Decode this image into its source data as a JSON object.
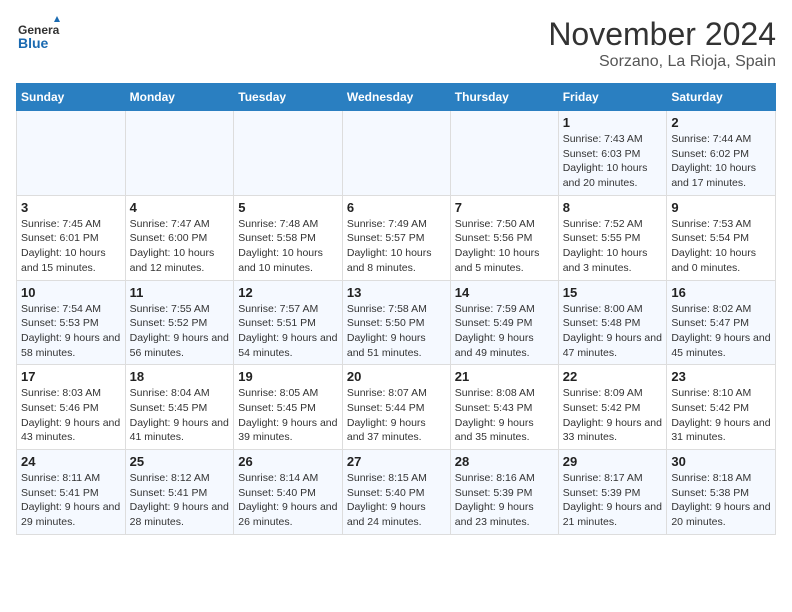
{
  "header": {
    "logo_line1": "General",
    "logo_line2": "Blue",
    "month": "November 2024",
    "location": "Sorzano, La Rioja, Spain"
  },
  "days_of_week": [
    "Sunday",
    "Monday",
    "Tuesday",
    "Wednesday",
    "Thursday",
    "Friday",
    "Saturday"
  ],
  "weeks": [
    [
      {
        "day": "",
        "info": ""
      },
      {
        "day": "",
        "info": ""
      },
      {
        "day": "",
        "info": ""
      },
      {
        "day": "",
        "info": ""
      },
      {
        "day": "",
        "info": ""
      },
      {
        "day": "1",
        "info": "Sunrise: 7:43 AM\nSunset: 6:03 PM\nDaylight: 10 hours and 20 minutes."
      },
      {
        "day": "2",
        "info": "Sunrise: 7:44 AM\nSunset: 6:02 PM\nDaylight: 10 hours and 17 minutes."
      }
    ],
    [
      {
        "day": "3",
        "info": "Sunrise: 7:45 AM\nSunset: 6:01 PM\nDaylight: 10 hours and 15 minutes."
      },
      {
        "day": "4",
        "info": "Sunrise: 7:47 AM\nSunset: 6:00 PM\nDaylight: 10 hours and 12 minutes."
      },
      {
        "day": "5",
        "info": "Sunrise: 7:48 AM\nSunset: 5:58 PM\nDaylight: 10 hours and 10 minutes."
      },
      {
        "day": "6",
        "info": "Sunrise: 7:49 AM\nSunset: 5:57 PM\nDaylight: 10 hours and 8 minutes."
      },
      {
        "day": "7",
        "info": "Sunrise: 7:50 AM\nSunset: 5:56 PM\nDaylight: 10 hours and 5 minutes."
      },
      {
        "day": "8",
        "info": "Sunrise: 7:52 AM\nSunset: 5:55 PM\nDaylight: 10 hours and 3 minutes."
      },
      {
        "day": "9",
        "info": "Sunrise: 7:53 AM\nSunset: 5:54 PM\nDaylight: 10 hours and 0 minutes."
      }
    ],
    [
      {
        "day": "10",
        "info": "Sunrise: 7:54 AM\nSunset: 5:53 PM\nDaylight: 9 hours and 58 minutes."
      },
      {
        "day": "11",
        "info": "Sunrise: 7:55 AM\nSunset: 5:52 PM\nDaylight: 9 hours and 56 minutes."
      },
      {
        "day": "12",
        "info": "Sunrise: 7:57 AM\nSunset: 5:51 PM\nDaylight: 9 hours and 54 minutes."
      },
      {
        "day": "13",
        "info": "Sunrise: 7:58 AM\nSunset: 5:50 PM\nDaylight: 9 hours and 51 minutes."
      },
      {
        "day": "14",
        "info": "Sunrise: 7:59 AM\nSunset: 5:49 PM\nDaylight: 9 hours and 49 minutes."
      },
      {
        "day": "15",
        "info": "Sunrise: 8:00 AM\nSunset: 5:48 PM\nDaylight: 9 hours and 47 minutes."
      },
      {
        "day": "16",
        "info": "Sunrise: 8:02 AM\nSunset: 5:47 PM\nDaylight: 9 hours and 45 minutes."
      }
    ],
    [
      {
        "day": "17",
        "info": "Sunrise: 8:03 AM\nSunset: 5:46 PM\nDaylight: 9 hours and 43 minutes."
      },
      {
        "day": "18",
        "info": "Sunrise: 8:04 AM\nSunset: 5:45 PM\nDaylight: 9 hours and 41 minutes."
      },
      {
        "day": "19",
        "info": "Sunrise: 8:05 AM\nSunset: 5:45 PM\nDaylight: 9 hours and 39 minutes."
      },
      {
        "day": "20",
        "info": "Sunrise: 8:07 AM\nSunset: 5:44 PM\nDaylight: 9 hours and 37 minutes."
      },
      {
        "day": "21",
        "info": "Sunrise: 8:08 AM\nSunset: 5:43 PM\nDaylight: 9 hours and 35 minutes."
      },
      {
        "day": "22",
        "info": "Sunrise: 8:09 AM\nSunset: 5:42 PM\nDaylight: 9 hours and 33 minutes."
      },
      {
        "day": "23",
        "info": "Sunrise: 8:10 AM\nSunset: 5:42 PM\nDaylight: 9 hours and 31 minutes."
      }
    ],
    [
      {
        "day": "24",
        "info": "Sunrise: 8:11 AM\nSunset: 5:41 PM\nDaylight: 9 hours and 29 minutes."
      },
      {
        "day": "25",
        "info": "Sunrise: 8:12 AM\nSunset: 5:41 PM\nDaylight: 9 hours and 28 minutes."
      },
      {
        "day": "26",
        "info": "Sunrise: 8:14 AM\nSunset: 5:40 PM\nDaylight: 9 hours and 26 minutes."
      },
      {
        "day": "27",
        "info": "Sunrise: 8:15 AM\nSunset: 5:40 PM\nDaylight: 9 hours and 24 minutes."
      },
      {
        "day": "28",
        "info": "Sunrise: 8:16 AM\nSunset: 5:39 PM\nDaylight: 9 hours and 23 minutes."
      },
      {
        "day": "29",
        "info": "Sunrise: 8:17 AM\nSunset: 5:39 PM\nDaylight: 9 hours and 21 minutes."
      },
      {
        "day": "30",
        "info": "Sunrise: 8:18 AM\nSunset: 5:38 PM\nDaylight: 9 hours and 20 minutes."
      }
    ]
  ]
}
